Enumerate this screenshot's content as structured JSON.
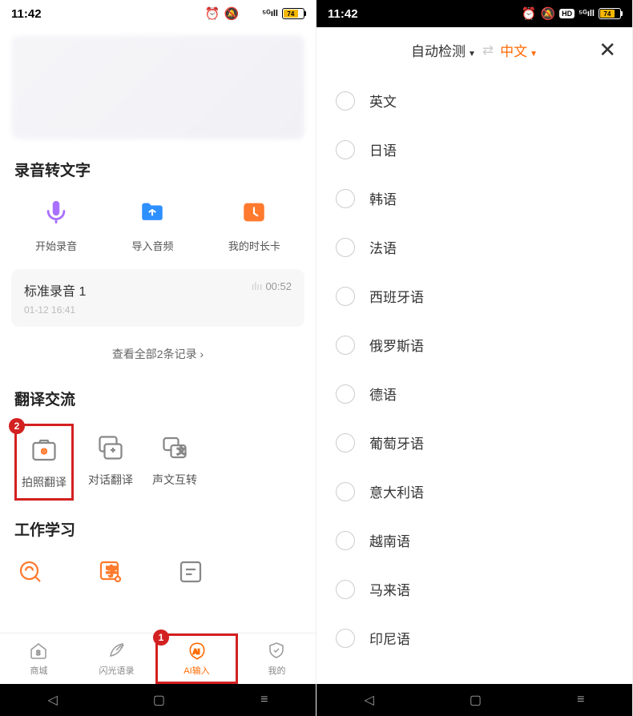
{
  "status": {
    "time": "11:42",
    "battery_pct": "74",
    "hd": "HD",
    "signal": "5G"
  },
  "left": {
    "sections": {
      "record": "录音转文字",
      "translate": "翻译交流",
      "work": "工作学习"
    },
    "actions": {
      "start_record": "开始录音",
      "import_audio": "导入音频",
      "my_card": "我的时长卡"
    },
    "recording": {
      "title": "标准录音 1",
      "date": "01-12 16:41",
      "duration": "00:52"
    },
    "view_all": "查看全部2条记录",
    "features": {
      "photo_translate": "拍照翻译",
      "dialogue_translate": "对话翻译",
      "sound_text": "声文互转"
    },
    "tabs": {
      "mall": "商城",
      "flash": "闪光语录",
      "ai_input": "AI输入",
      "mine": "我的"
    },
    "badges": {
      "num1": "1",
      "num2": "2"
    }
  },
  "right": {
    "from_lang": "自动检测",
    "to_lang": "中文",
    "languages": [
      "英文",
      "日语",
      "韩语",
      "法语",
      "西班牙语",
      "俄罗斯语",
      "德语",
      "葡萄牙语",
      "意大利语",
      "越南语",
      "马来语",
      "印尼语"
    ]
  }
}
